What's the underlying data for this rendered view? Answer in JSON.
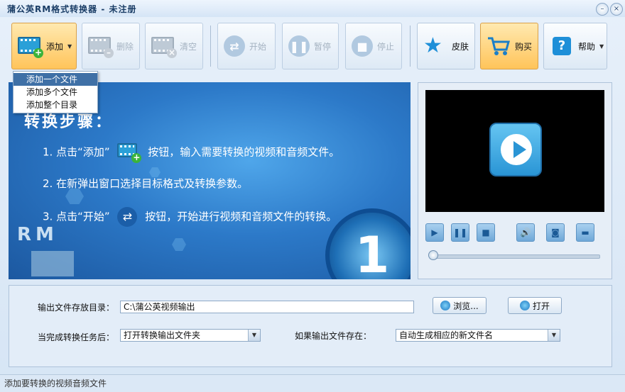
{
  "window": {
    "title": "蒲公英RM格式转换器 - 未注册",
    "minimize": "–",
    "close": "×"
  },
  "toolbar": {
    "add": "添加",
    "delete": "删除",
    "clear": "清空",
    "start": "开始",
    "pause": "暂停",
    "stop": "停止",
    "skin": "皮肤",
    "buy": "购买",
    "help": "帮助"
  },
  "add_menu": {
    "items": [
      "添加一个文件",
      "添加多个文件",
      "添加整个目录"
    ],
    "active_index": 0
  },
  "banner": {
    "title": "转换步骤：",
    "step1": {
      "a": "1. 点击“添加”",
      "b": "按钮，输入需要转换的视频和音频文件。"
    },
    "step2": "2. 在新弹出窗口选择目标格式及转换参数。",
    "step3": {
      "a": "3. 点击“开始”",
      "b": "按钮，开始进行视频和音频文件的转换。"
    },
    "logo": "RM",
    "number": "1"
  },
  "player": {
    "controls": [
      "play",
      "pause",
      "stop",
      "volume",
      "snapshot",
      "folder"
    ],
    "position": 0
  },
  "settings": {
    "output_dir_label": "输出文件存放目录：",
    "output_dir_value": "C:\\蒲公英视频输出",
    "browse": "浏览...",
    "open": "打开",
    "after_label": "当完成转换任务后：",
    "after_value": "打开转换输出文件夹",
    "exists_label": "如果输出文件存在：",
    "exists_value": "自动生成相应的新文件名"
  },
  "status": "添加要转换的视频音频文件"
}
